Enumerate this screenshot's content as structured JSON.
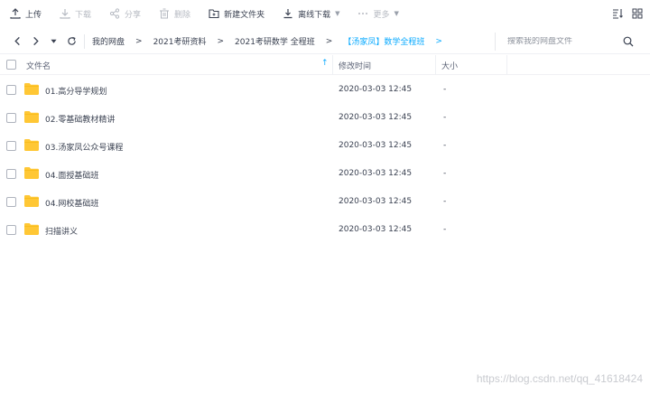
{
  "toolbar": {
    "upload_label": "上传",
    "download_label": "下载",
    "share_label": "分享",
    "delete_label": "删除",
    "new_folder_label": "新建文件夹",
    "offline_download_label": "离线下载",
    "more_label": "更多"
  },
  "breadcrumb": {
    "items": [
      "我的网盘",
      "2021考研资料",
      "2021考研数学 全程班",
      "【汤家凤】数学全程班"
    ],
    "separator": ">"
  },
  "search": {
    "placeholder": "搜索我的网盘文件"
  },
  "table": {
    "headers": {
      "name": "文件名",
      "modified": "修改时间",
      "size": "大小"
    },
    "rows": [
      {
        "name": "01.高分导学规划",
        "modified": "2020-03-03 12:45",
        "size": "-"
      },
      {
        "name": "02.零基础教材精讲",
        "modified": "2020-03-03 12:45",
        "size": "-"
      },
      {
        "name": "03.汤家凤公众号课程",
        "modified": "2020-03-03 12:45",
        "size": "-"
      },
      {
        "name": "04.面授基础班",
        "modified": "2020-03-03 12:45",
        "size": "-"
      },
      {
        "name": "04.网校基础班",
        "modified": "2020-03-03 12:45",
        "size": "-"
      },
      {
        "name": "扫描讲义",
        "modified": "2020-03-03 12:45",
        "size": "-"
      }
    ]
  },
  "watermark": "https://blog.csdn.net/qq_41618424",
  "colors": {
    "accent": "#09aaff",
    "folder": "#ffc735",
    "text": "#3b4252",
    "disabled": "#b6bac2"
  },
  "icons": {
    "upload": "upload-icon",
    "download": "download-icon",
    "share": "share-icon",
    "delete": "trash-icon",
    "new_folder": "folder-plus-icon",
    "offline": "offline-download-icon",
    "more": "more-dots-icon",
    "sort": "sort-icon",
    "view": "grid-view-icon",
    "back": "chevron-left-icon",
    "forward": "chevron-right-icon",
    "history": "caret-down-icon",
    "refresh": "refresh-icon",
    "search": "search-icon",
    "folder": "folder-icon"
  }
}
